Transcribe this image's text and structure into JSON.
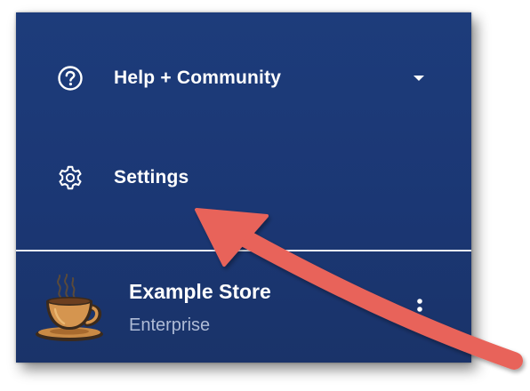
{
  "menu": {
    "help": {
      "label": "Help + Community",
      "icon": "help-circle-icon"
    },
    "settings": {
      "label": "Settings",
      "icon": "gear-icon"
    }
  },
  "store": {
    "name": "Example Store",
    "plan": "Enterprise",
    "logo": "coffee-cup-logo",
    "more_icon": "more-vertical-icon"
  },
  "annotation": {
    "type": "arrow",
    "color": "#e8645a",
    "points_to": "settings"
  },
  "colors": {
    "panel_bg": "#1c3876",
    "text": "#ffffff",
    "secondary_text": "#aebbd6",
    "divider": "#e9edf5"
  }
}
